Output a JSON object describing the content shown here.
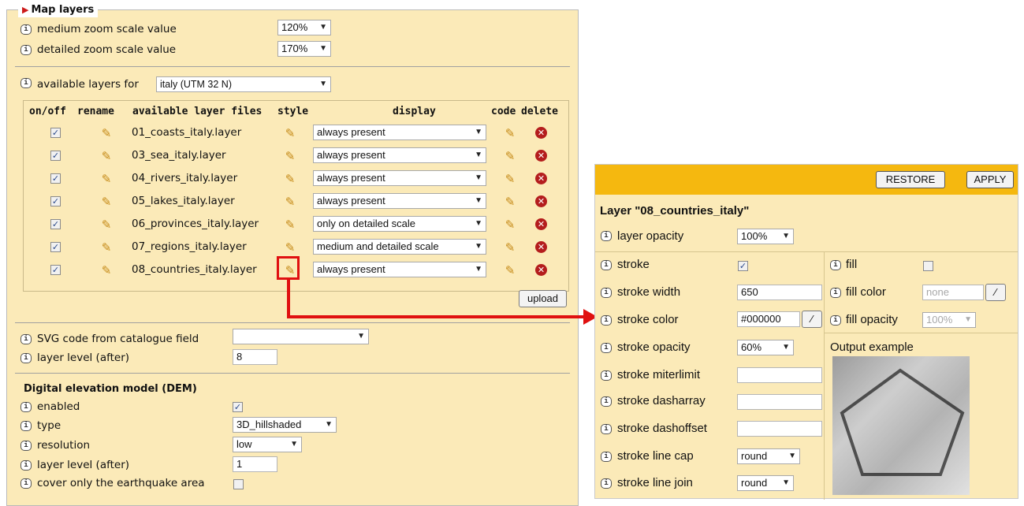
{
  "left": {
    "legend": "Map layers",
    "medium_zoom": {
      "label": "medium zoom scale value",
      "value": "120%"
    },
    "detailed_zoom": {
      "label": "detailed zoom scale value",
      "value": "170%"
    },
    "available_layers": {
      "label": "available layers for",
      "value": "italy (UTM 32 N)"
    },
    "table": {
      "headers": [
        "on/off",
        "rename",
        "available layer files",
        "style",
        "display",
        "code",
        "delete"
      ],
      "rows": [
        {
          "file": "01_coasts_italy.layer",
          "display": "always present",
          "on": true
        },
        {
          "file": "03_sea_italy.layer",
          "display": "always present",
          "on": true
        },
        {
          "file": "04_rivers_italy.layer",
          "display": "always present",
          "on": true
        },
        {
          "file": "05_lakes_italy.layer",
          "display": "always present",
          "on": true
        },
        {
          "file": "06_provinces_italy.layer",
          "display": "only on detailed scale",
          "on": true
        },
        {
          "file": "07_regions_italy.layer",
          "display": "medium and detailed scale",
          "on": true
        },
        {
          "file": "08_countries_italy.layer",
          "display": "always present",
          "on": true
        }
      ],
      "upload_label": "upload"
    },
    "svg_code": {
      "label": "SVG code from catalogue field",
      "value": ""
    },
    "layer_level": {
      "label": "layer level (after)",
      "value": "8"
    },
    "dem": {
      "title": "Digital elevation model (DEM)",
      "enabled_label": "enabled",
      "enabled": true,
      "type_label": "type",
      "type_value": "3D_hillshaded",
      "resolution_label": "resolution",
      "resolution_value": "low",
      "level_label": "layer level (after)",
      "level_value": "1",
      "cover_label": "cover only the earthquake area",
      "cover": false
    }
  },
  "right": {
    "restore_label": "RESTORE",
    "apply_label": "APPLY",
    "title": "Layer \"08_countries_italy\"",
    "opacity": {
      "label": "layer opacity",
      "value": "100%"
    },
    "stroke": {
      "label": "stroke",
      "checked": true
    },
    "stroke_width": {
      "label": "stroke width",
      "value": "650"
    },
    "stroke_color": {
      "label": "stroke color",
      "value": "#000000"
    },
    "stroke_opacity": {
      "label": "stroke opacity",
      "value": "60%"
    },
    "stroke_miterlimit": {
      "label": "stroke miterlimit",
      "value": ""
    },
    "stroke_dasharray": {
      "label": "stroke dasharray",
      "value": ""
    },
    "stroke_dashoffset": {
      "label": "stroke dashoffset",
      "value": ""
    },
    "stroke_linecap": {
      "label": "stroke line cap",
      "value": "round"
    },
    "stroke_linejoin": {
      "label": "stroke line join",
      "value": "round"
    },
    "fill": {
      "label": "fill",
      "checked": false
    },
    "fill_color": {
      "label": "fill color",
      "placeholder": "none"
    },
    "fill_opacity": {
      "label": "fill opacity",
      "value": "100%"
    },
    "output_label": "Output example"
  },
  "icons": {
    "info": "i",
    "arrow": "▼",
    "check": "✓",
    "pencil": "✎",
    "delete": "✕"
  },
  "colors": {
    "header": "#f5b80f",
    "panel": "#fbeab8",
    "highlight": "#e01010",
    "delete": "#b41d1d"
  }
}
